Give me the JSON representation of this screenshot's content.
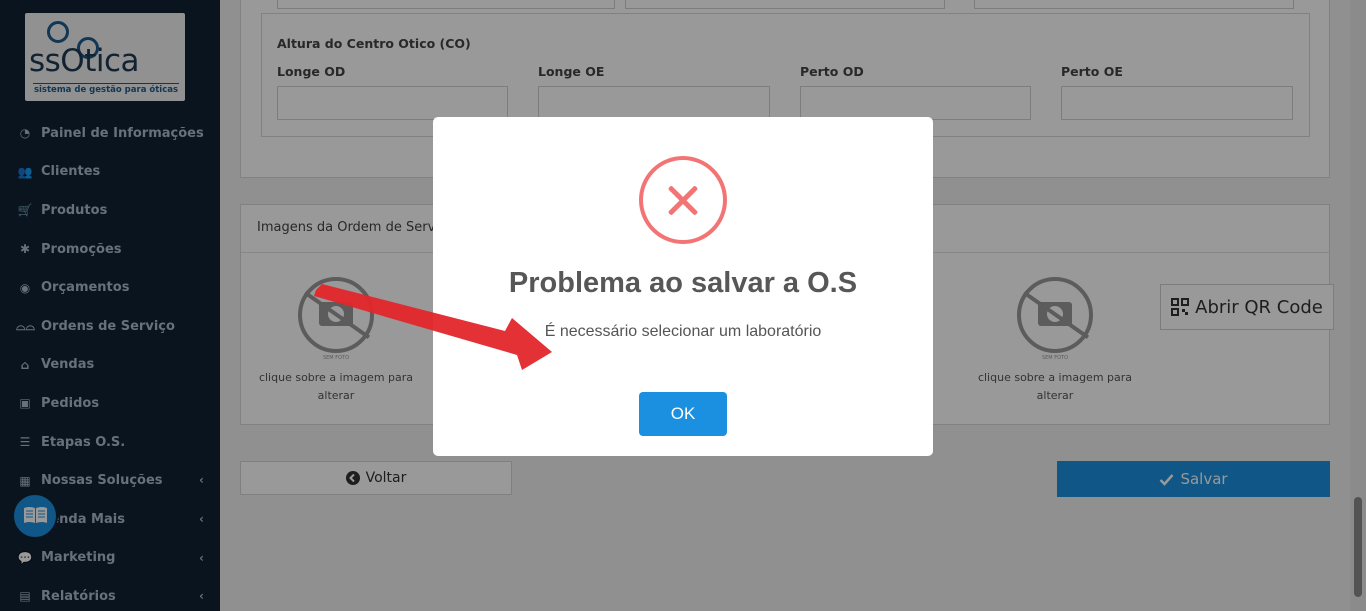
{
  "brand": {
    "logo_text": "ssOtica",
    "tagline": "sistema de gestão para óticas"
  },
  "sidebar": {
    "items": [
      {
        "label": "Painel de Informações",
        "icon": "dashboard-icon",
        "submenu": false
      },
      {
        "label": "Clientes",
        "icon": "users-icon",
        "submenu": false
      },
      {
        "label": "Produtos",
        "icon": "cart-icon",
        "submenu": false
      },
      {
        "label": "Promoções",
        "icon": "asterisk-icon",
        "submenu": false
      },
      {
        "label": "Orçamentos",
        "icon": "user-money-icon",
        "submenu": false
      },
      {
        "label": "Ordens de Serviço",
        "icon": "glasses-icon",
        "submenu": false
      },
      {
        "label": "Vendas",
        "icon": "basket-icon",
        "submenu": false
      },
      {
        "label": "Pedidos",
        "icon": "inbox-icon",
        "submenu": false
      },
      {
        "label": "Etapas O.S.",
        "icon": "tasks-icon",
        "submenu": false
      },
      {
        "label": "Nossas Soluções",
        "icon": "box-icon",
        "submenu": true
      },
      {
        "label": "Venda Mais",
        "icon": "chart-icon",
        "submenu": true
      },
      {
        "label": "Marketing",
        "icon": "comments-icon",
        "submenu": true
      },
      {
        "label": "Relatórios",
        "icon": "report-icon",
        "submenu": true
      }
    ]
  },
  "form": {
    "section_label": "Altura do Centro Otico (CO)",
    "fields": [
      {
        "label": "Longe OD",
        "value": ""
      },
      {
        "label": "Longe OE",
        "value": ""
      },
      {
        "label": "Perto OD",
        "value": ""
      },
      {
        "label": "Perto OE",
        "value": ""
      }
    ]
  },
  "images_panel": {
    "title": "Imagens da Ordem de Serviço",
    "no_photo_text": "SEM FOTO",
    "caption": "clique sobre a imagem para alterar",
    "qr_button": "Abrir QR Code"
  },
  "actions": {
    "back": "Voltar",
    "save": "Salvar"
  },
  "modal": {
    "title": "Problema ao salvar a O.S",
    "message": "É necessário selecionar um laboratório",
    "ok": "OK"
  },
  "colors": {
    "sidebar_bg": "#0f2233",
    "primary": "#1b8fe0",
    "error": "#f27474",
    "arrow": "#e3262b"
  }
}
